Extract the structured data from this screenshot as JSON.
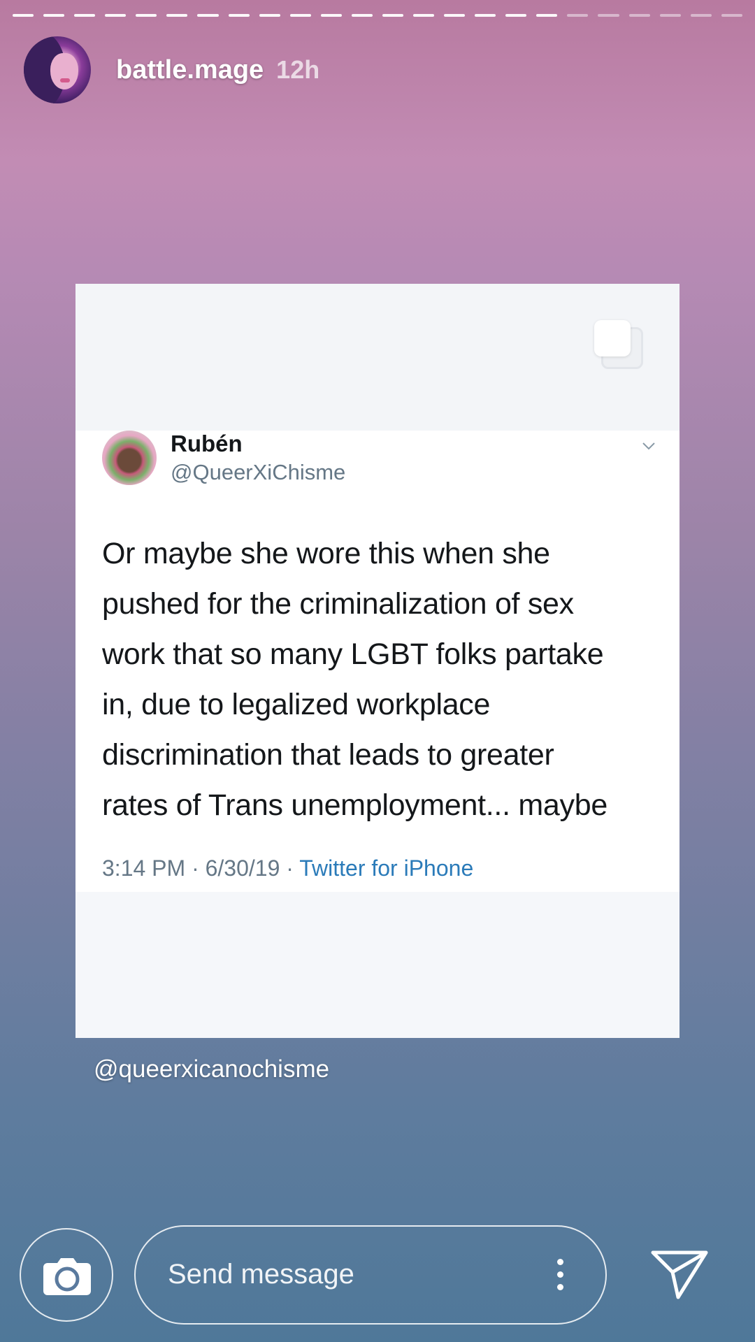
{
  "story": {
    "progress": {
      "segments": 24,
      "viewed": 18
    },
    "user": {
      "username": "battle.mage",
      "time_ago": "12h"
    },
    "mention": "@queerxicanochisme"
  },
  "tweet": {
    "display_name": "Rubén",
    "handle": "@QueerXiChisme",
    "text_lines": [
      "Or maybe she wore this when she",
      "pushed for the criminalization of sex",
      "work that so many LGBT folks partake",
      "in, due to legalized workplace",
      "discrimination that leads to greater",
      "rates of Trans unemployment... maybe"
    ],
    "timestamp": "3:14 PM · 6/30/19 · ",
    "source": "Twitter for iPhone"
  },
  "footer": {
    "message_placeholder": "Send message"
  },
  "icons": {
    "camera": "camera-icon",
    "more": "more-vertical-icon",
    "send": "send-icon",
    "multi": "multiple-photos-icon",
    "chevron": "chevron-down-icon"
  }
}
